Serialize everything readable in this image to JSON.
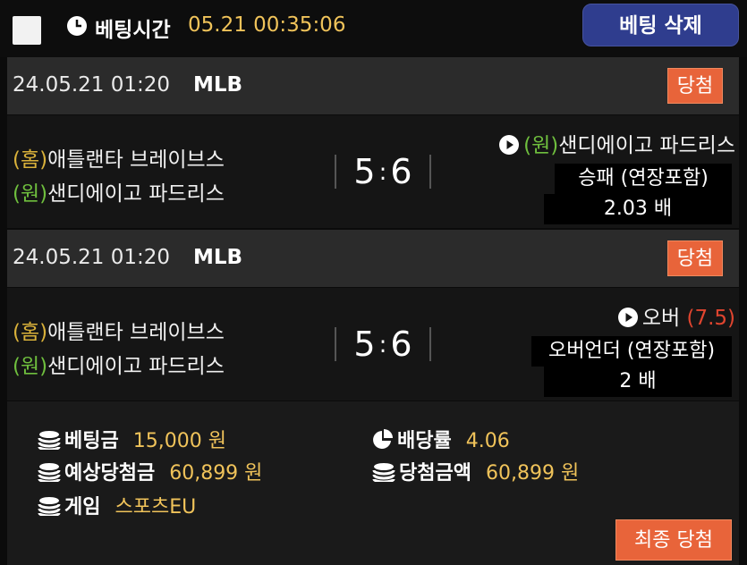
{
  "header": {
    "bet_time_label": "베팅시간",
    "bet_time_value": "05.21 00:35:06",
    "delete_label": "베팅 삭제"
  },
  "games": [
    {
      "date": "24.05.21 01:20",
      "league": "MLB",
      "status": "당첨",
      "home_tag": "(홈)",
      "home_team": "애틀랜타 브레이브스",
      "away_tag": "(원)",
      "away_team": "샌디에이고 파드리스",
      "score_home": "5",
      "score_away": "6",
      "pick_tag": "(원)",
      "pick": "샌디에이고 파드리스",
      "pick_extra": "",
      "market": "승패 (연장포함)",
      "odds": "2.03 배"
    },
    {
      "date": "24.05.21 01:20",
      "league": "MLB",
      "status": "당첨",
      "home_tag": "(홈)",
      "home_team": "애틀랜타 브레이브스",
      "away_tag": "(원)",
      "away_team": "샌디에이고 파드리스",
      "score_home": "5",
      "score_away": "6",
      "pick_tag": "",
      "pick": "오버",
      "pick_extra": "(7.5)",
      "market": "오버언더 (연장포함)",
      "odds": "2 배"
    }
  ],
  "summary": {
    "bet_amount_label": "베팅금",
    "bet_amount_value": "15,000 원",
    "odds_label": "배당률",
    "odds_value": "4.06",
    "expected_label": "예상당첨금",
    "expected_value": "60,899 원",
    "win_amount_label": "당첨금액",
    "win_amount_value": "60,899 원",
    "game_label": "게임",
    "game_value": "스포츠EU",
    "final_label": "최종 당첨"
  },
  "colors": {
    "accent_gold": "#f0c35a",
    "win_orange": "#e8643a",
    "delete_blue": "#2f3d8e",
    "home_tag": "#d9b13a",
    "away_tag": "#6fbf3e"
  },
  "icons": [
    "clock-icon",
    "play-icon",
    "coin-stack-icon",
    "pie-chart-icon"
  ]
}
